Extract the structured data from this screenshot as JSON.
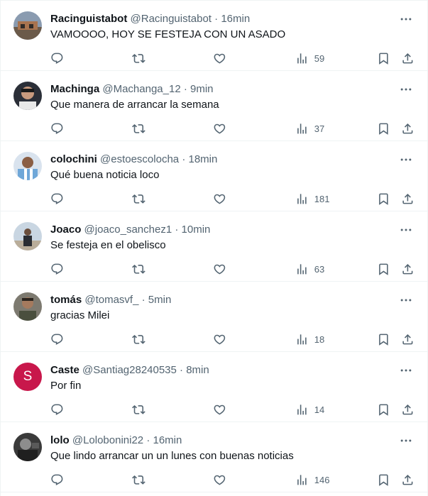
{
  "tweets": [
    {
      "name": "Racinguistabot",
      "handle": "@Racinguistabot",
      "sep": "·",
      "time": "16min",
      "text": "VAMOOOO, HOY SE FESTEJA CON UN ASADO",
      "views": "59",
      "avatar": "photo"
    },
    {
      "name": "Machinga",
      "handle": "@Machanga_12",
      "sep": "·",
      "time": "9min",
      "text": "Que manera de arrancar la semana",
      "views": "37",
      "avatar": "photo"
    },
    {
      "name": "colochini",
      "handle": "@estoescolocha",
      "sep": "·",
      "time": "18min",
      "text": "Qué buena noticia loco",
      "views": "181",
      "avatar": "photo"
    },
    {
      "name": "Joaco",
      "handle": "@joaco_sanchez1",
      "sep": "·",
      "time": "10min",
      "text": "Se festeja en el obelisco",
      "views": "63",
      "avatar": "photo"
    },
    {
      "name": "tomás",
      "handle": "@tomasvf_",
      "sep": "·",
      "time": "5min",
      "text": "gracias Milei",
      "views": "18",
      "avatar": "photo"
    },
    {
      "name": "Caste",
      "handle": "@Santiag28240535",
      "sep": "·",
      "time": "8min",
      "text": "Por fin",
      "views": "14",
      "avatar": "letter",
      "avatar_letter": "S",
      "avatar_color": "#c8174b"
    },
    {
      "name": "lolo",
      "handle": "@Lolobonini22",
      "sep": "·",
      "time": "16min",
      "text": "Que lindo arrancar un un lunes con buenas noticias",
      "views": "146",
      "avatar": "photo"
    }
  ],
  "icons": {
    "more": "more-horizontal-icon",
    "reply": "reply-icon",
    "retweet": "retweet-icon",
    "like": "heart-icon",
    "views": "views-chart-icon",
    "bookmark": "bookmark-icon",
    "share": "share-icon"
  },
  "colors": {
    "text": "#0f1419",
    "secondary": "#536471",
    "border": "#eff3f4"
  }
}
